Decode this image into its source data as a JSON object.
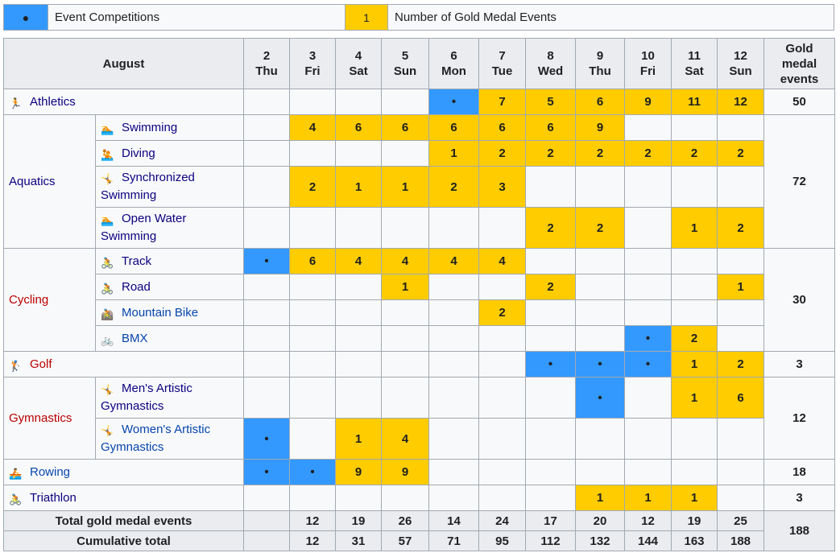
{
  "legend": {
    "competition_symbol": "●",
    "competition_label": "Event Competitions",
    "gold_symbol": "1",
    "gold_label": "Number of Gold Medal Events",
    "colors": {
      "competition": "#3399ff",
      "gold": "#ffcc00"
    }
  },
  "header": {
    "month": "August",
    "days": [
      {
        "num": "2",
        "dow": "Thu"
      },
      {
        "num": "3",
        "dow": "Fri"
      },
      {
        "num": "4",
        "dow": "Sat"
      },
      {
        "num": "5",
        "dow": "Sun"
      },
      {
        "num": "6",
        "dow": "Mon"
      },
      {
        "num": "7",
        "dow": "Tue"
      },
      {
        "num": "8",
        "dow": "Wed"
      },
      {
        "num": "9",
        "dow": "Thu"
      },
      {
        "num": "10",
        "dow": "Fri"
      },
      {
        "num": "11",
        "dow": "Sat"
      },
      {
        "num": "12",
        "dow": "Sun"
      }
    ],
    "gold_col_l1": "Gold",
    "gold_col_l2": "medal",
    "gold_col_l3": "events"
  },
  "rows": {
    "athletics": {
      "sport": "Athletics",
      "icon": "athletics-icon",
      "cells": [
        "",
        "",
        "",
        "",
        "•",
        "7",
        "5",
        "6",
        "9",
        "11",
        "12"
      ],
      "total": "50"
    },
    "aquatics": {
      "sport": "Aquatics",
      "total": "72",
      "disciplines": [
        {
          "name": "Swimming",
          "icon": "swimming-icon",
          "cells": [
            "",
            "4",
            "6",
            "6",
            "6",
            "6",
            "6",
            "9",
            "",
            "",
            ""
          ]
        },
        {
          "name": "Diving",
          "icon": "diving-icon",
          "cells": [
            "",
            "",
            "",
            "",
            "1",
            "2",
            "2",
            "2",
            "2",
            "2",
            "2"
          ]
        },
        {
          "name_l1": "Synchronized",
          "name_l2": "Swimming",
          "icon": "synchronized-swimming-icon",
          "cells": [
            "",
            "2",
            "1",
            "1",
            "2",
            "3",
            "",
            "",
            "",
            "",
            ""
          ]
        },
        {
          "name_l1": "Open Water",
          "name_l2": "Swimming",
          "icon": "open-water-swimming-icon",
          "cells": [
            "",
            "",
            "",
            "",
            "",
            "",
            "2",
            "2",
            "",
            "1",
            "2"
          ]
        }
      ]
    },
    "cycling": {
      "sport": "Cycling",
      "total": "30",
      "disciplines": [
        {
          "name": "Track",
          "icon": "track-cycling-icon",
          "cells": [
            "•",
            "6",
            "4",
            "4",
            "4",
            "4",
            "",
            "",
            "",
            "",
            ""
          ]
        },
        {
          "name": "Road",
          "icon": "road-cycling-icon",
          "cells": [
            "",
            "",
            "",
            "1",
            "",
            "",
            "2",
            "",
            "",
            "",
            "1"
          ]
        },
        {
          "name": "Mountain Bike",
          "icon": "mountain-bike-icon",
          "cells": [
            "",
            "",
            "",
            "",
            "",
            "2",
            "",
            "",
            "",
            "",
            ""
          ]
        },
        {
          "name": "BMX",
          "icon": "bmx-icon",
          "cells": [
            "",
            "",
            "",
            "",
            "",
            "",
            "",
            "",
            "•",
            "2",
            ""
          ]
        }
      ]
    },
    "golf": {
      "sport": "Golf",
      "icon": "golf-icon",
      "cells": [
        "",
        "",
        "",
        "",
        "",
        "",
        "•",
        "•",
        "•",
        "1",
        "2"
      ],
      "total": "3"
    },
    "gymnastics": {
      "sport": "Gymnastics",
      "total": "12",
      "disciplines": [
        {
          "name_l1": "Men's Artistic",
          "name_l2": "Gymnastics",
          "icon": "mens-artistic-gymnastics-icon",
          "cells": [
            "",
            "",
            "",
            "",
            "",
            "",
            "",
            "•",
            "",
            "1",
            "6"
          ]
        },
        {
          "name_l1": "Women's Artistic",
          "name_l2": "Gymnastics",
          "icon": "womens-artistic-gymnastics-icon",
          "cells": [
            "•",
            "",
            "1",
            "4",
            "",
            "",
            "",
            "",
            "",
            "",
            ""
          ]
        }
      ]
    },
    "rowing": {
      "sport": "Rowing",
      "icon": "rowing-icon",
      "cells": [
        "•",
        "•",
        "9",
        "9",
        "",
        "",
        "",
        "",
        "",
        "",
        ""
      ],
      "total": "18"
    },
    "triathlon": {
      "sport": "Triathlon",
      "icon": "triathlon-icon",
      "cells": [
        "",
        "",
        "",
        "",
        "",
        "",
        "",
        "1",
        "1",
        "1",
        ""
      ],
      "total": "3"
    }
  },
  "totals": {
    "daily_label": "Total gold medal events",
    "daily": [
      "",
      "12",
      "19",
      "26",
      "14",
      "24",
      "17",
      "20",
      "12",
      "19",
      "25"
    ],
    "cumulative_label": "Cumulative total",
    "cumulative": [
      "",
      "12",
      "31",
      "57",
      "71",
      "95",
      "112",
      "132",
      "144",
      "163",
      "188"
    ],
    "grand_total": "188"
  }
}
